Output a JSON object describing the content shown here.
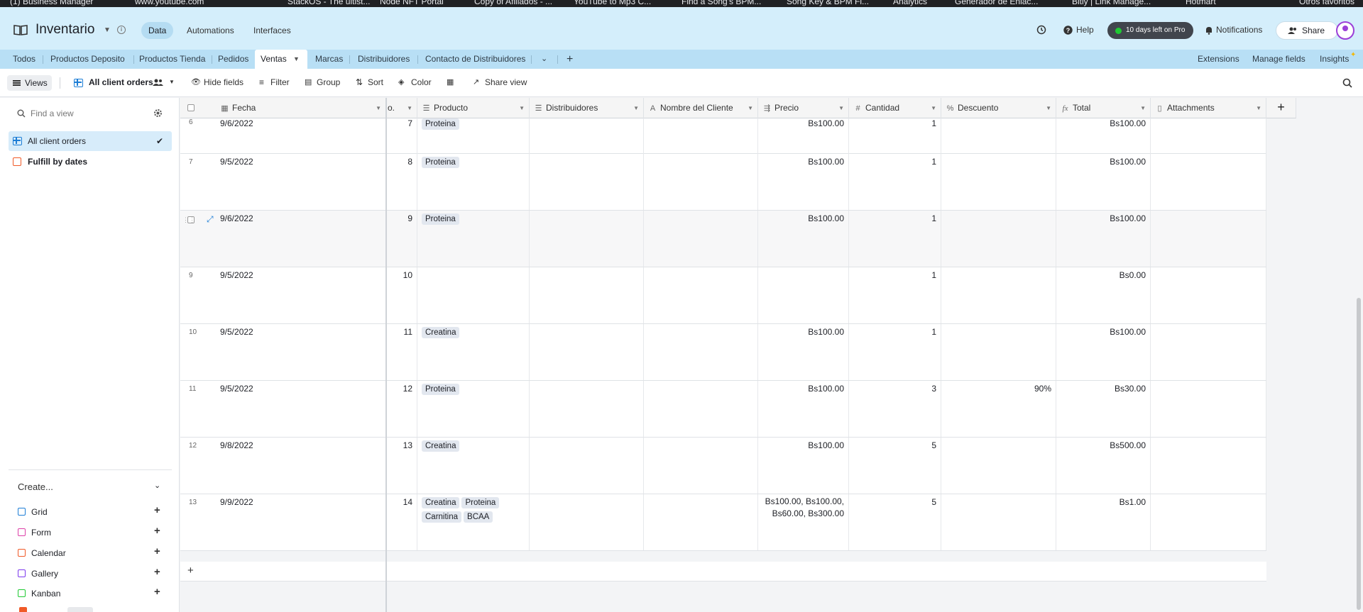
{
  "bookmarks": [
    "(1) Business Manager",
    "www.youtube.com",
    "StackOS - The ultist...",
    "Node NFT Portal",
    "Copy of Afiliados - ...",
    "YouTube to Mp3 C...",
    "Find a Song's BPM...",
    "Song Key & BPM Fi...",
    "Analytics",
    "Generador de Enlac...",
    "Bitly | Link Manage...",
    "Hotmart",
    "Otros favoritos"
  ],
  "header": {
    "base_title": "Inventario",
    "tabs": [
      "Data",
      "Automations",
      "Interfaces"
    ],
    "help": "Help",
    "trial": "10 days left on Pro",
    "notifications": "Notifications",
    "share": "Share"
  },
  "tables": {
    "tabs": [
      "Todos",
      "Productos Deposito",
      "Productos Tienda",
      "Pedidos",
      "Ventas",
      "Marcas",
      "Distribuidores",
      "Contacto de Distribuidores"
    ],
    "active": "Ventas",
    "right": [
      "Extensions",
      "Manage fields",
      "Insights"
    ]
  },
  "toolbar": {
    "views": "Views",
    "current_view": "All client orders",
    "hide_fields": "Hide fields",
    "filter": "Filter",
    "group": "Group",
    "sort": "Sort",
    "color": "Color",
    "share_view": "Share view"
  },
  "sidebar": {
    "search_placeholder": "Find a view",
    "views": [
      "All client orders",
      "Fulfill by dates"
    ],
    "create_label": "Create...",
    "create_items": [
      "Grid",
      "Form",
      "Calendar",
      "Gallery",
      "Kanban"
    ]
  },
  "columns": {
    "fecha": "Fecha",
    "no": "o.",
    "producto": "Producto",
    "distribuidores": "Distribuidores",
    "cliente": "Nombre del Cliente",
    "precio": "Precio",
    "cantidad": "Cantidad",
    "descuento": "Descuento",
    "total": "Total",
    "attachments": "Attachments"
  },
  "rows": [
    {
      "rn": "6",
      "fecha": "9/6/2022",
      "no": "7",
      "productos": [
        "Proteina"
      ],
      "precio": "Bs100.00",
      "cantidad": "1",
      "descuento": "",
      "total": "Bs100.00"
    },
    {
      "rn": "7",
      "fecha": "9/5/2022",
      "no": "8",
      "productos": [
        "Proteina"
      ],
      "precio": "Bs100.00",
      "cantidad": "1",
      "descuento": "",
      "total": "Bs100.00"
    },
    {
      "rn": "",
      "fecha": "9/6/2022",
      "no": "9",
      "productos": [
        "Proteina"
      ],
      "precio": "Bs100.00",
      "cantidad": "1",
      "descuento": "",
      "total": "Bs100.00"
    },
    {
      "rn": "9",
      "fecha": "9/5/2022",
      "no": "10",
      "productos": [],
      "precio": "",
      "cantidad": "1",
      "descuento": "",
      "total": "Bs0.00"
    },
    {
      "rn": "10",
      "fecha": "9/5/2022",
      "no": "11",
      "productos": [
        "Creatina"
      ],
      "precio": "Bs100.00",
      "cantidad": "1",
      "descuento": "",
      "total": "Bs100.00"
    },
    {
      "rn": "11",
      "fecha": "9/5/2022",
      "no": "12",
      "productos": [
        "Proteina"
      ],
      "precio": "Bs100.00",
      "cantidad": "3",
      "descuento": "90%",
      "total": "Bs30.00"
    },
    {
      "rn": "12",
      "fecha": "9/8/2022",
      "no": "13",
      "productos": [
        "Creatina"
      ],
      "precio": "Bs100.00",
      "cantidad": "5",
      "descuento": "",
      "total": "Bs500.00"
    },
    {
      "rn": "13",
      "fecha": "9/9/2022",
      "no": "14",
      "productos": [
        "Creatina",
        "Proteina",
        "Carnitina",
        "BCAA"
      ],
      "precio": "Bs100.00, Bs100.00, Bs60.00, Bs300.00",
      "cantidad": "5",
      "descuento": "",
      "total": "Bs1.00"
    }
  ],
  "colors": {
    "accent": "#1d7ed6",
    "header_bg": "#d4eefb",
    "tabs_bg": "#b8dff5"
  }
}
